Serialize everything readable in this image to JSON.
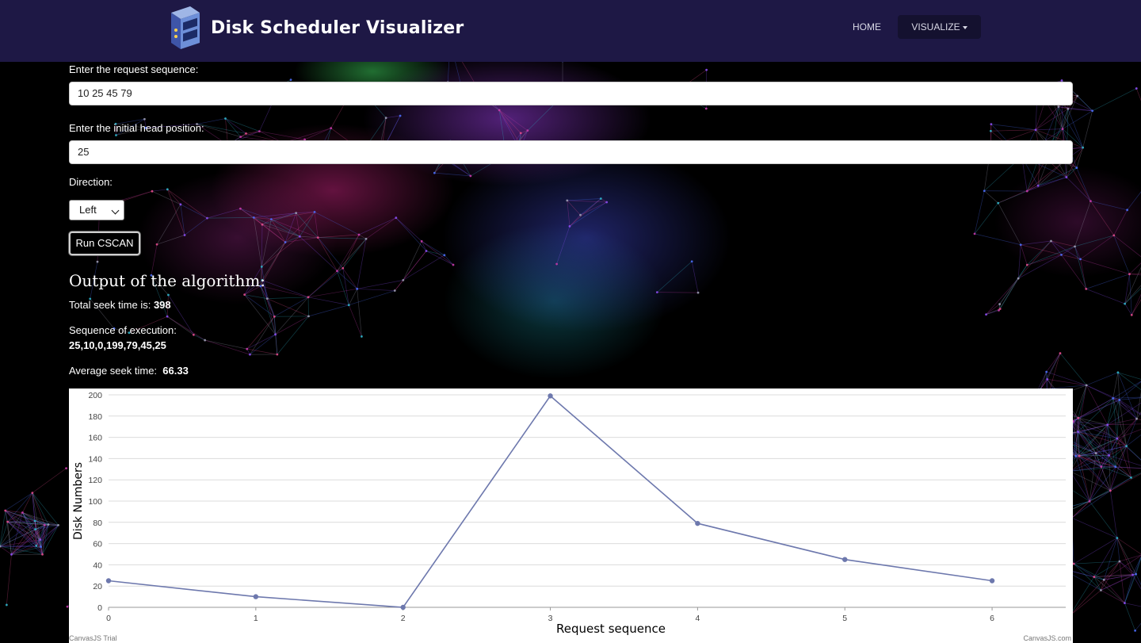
{
  "navbar": {
    "brand_title": "Disk Scheduler Visualizer",
    "home_label": "HOME",
    "visualize_label": "VISUALIZE"
  },
  "form": {
    "request_label": "Enter the request sequence:",
    "request_value": "10 25 45 79",
    "head_label": "Enter the initial head position:",
    "head_value": "25",
    "direction_label": "Direction:",
    "direction_value": "Left",
    "run_label": "Run CSCAN"
  },
  "output": {
    "heading": "Output of the algorithm:",
    "seek_label": "Total seek time is:",
    "seek_value": "398",
    "sequence_label": "Sequence of execution:",
    "sequence_value": "25,10,0,199,79,45,25",
    "avg_label": "Average seek time:",
    "avg_value": "66.33"
  },
  "chart_data": {
    "type": "line",
    "x": [
      0,
      1,
      2,
      3,
      4,
      5,
      6
    ],
    "y": [
      25,
      10,
      0,
      199,
      79,
      45,
      25
    ],
    "xlabel": "Request sequence",
    "ylabel": "Disk Numbers",
    "xlim": [
      0,
      6.5
    ],
    "ylim": [
      0,
      200
    ],
    "yticks": [
      0,
      20,
      40,
      60,
      80,
      100,
      120,
      140,
      160,
      180,
      200
    ],
    "xticks": [
      0,
      1,
      2,
      3,
      4,
      5,
      6
    ],
    "grid": "horizontal",
    "line_color": "#6d78ad",
    "trial_label": "CanvasJS Trial",
    "credit_label": "CanvasJS.com"
  }
}
